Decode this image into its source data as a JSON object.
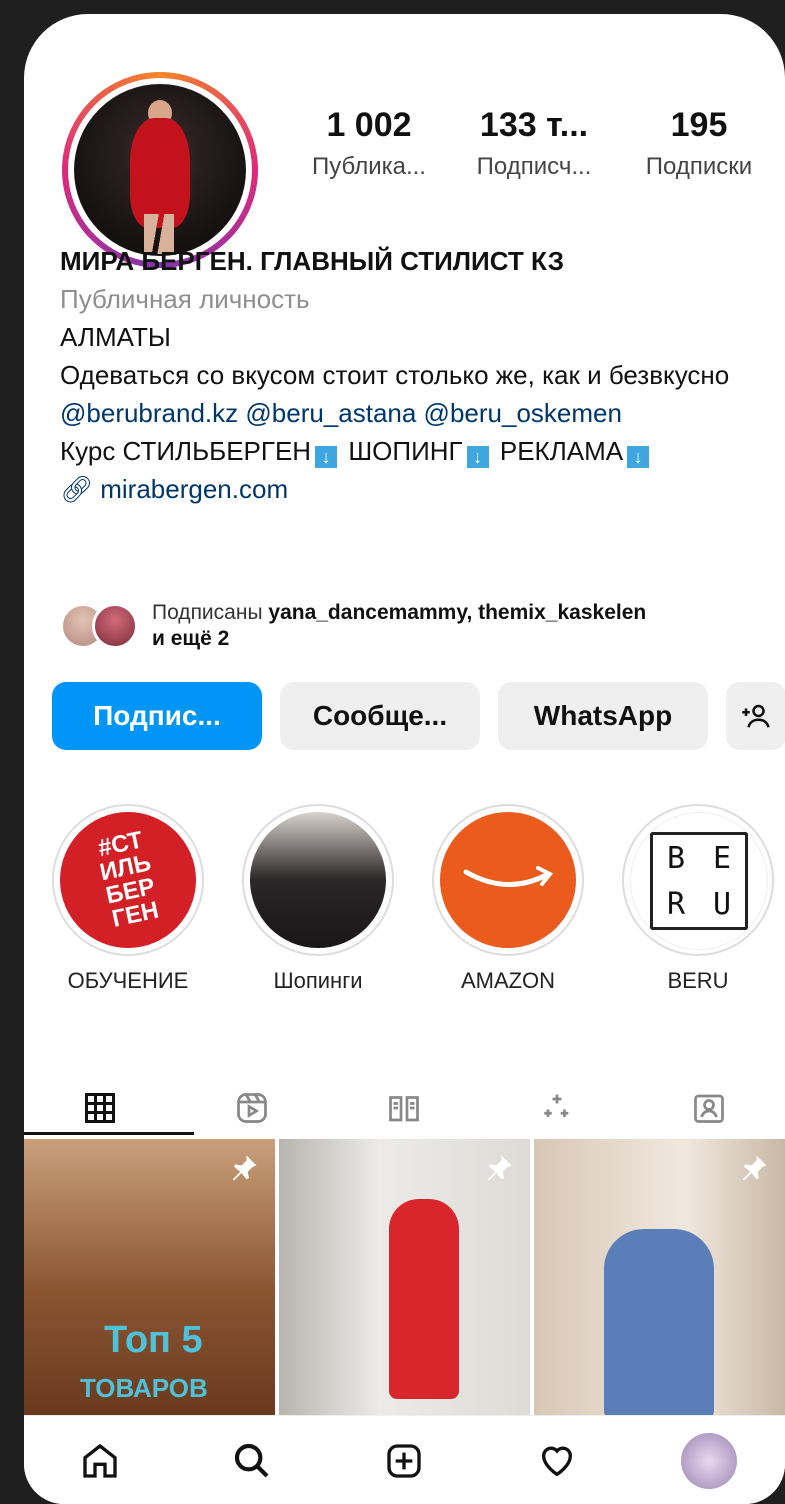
{
  "profile": {
    "stats": [
      {
        "value": "1 002",
        "label": "Публика..."
      },
      {
        "value": "133 т...",
        "label": "Подписч..."
      },
      {
        "value": "195",
        "label": "Подписки"
      }
    ],
    "name": "МИРА БЕРГЕН. ГЛАВНЫЙ СТИЛИСТ КЗ",
    "category": "Публичная личность",
    "city": "АЛМАТЫ",
    "bio_line": "Одеваться со вкусом стоит столько же, как и безвкусно",
    "mentions": "@berubrand.kz @beru_astana @beru_oskemen",
    "course_line": {
      "part1": "Курс СТИЛЬБЕРГЕН",
      "part2": "ШОПИНГ",
      "part3": "РЕКЛАМА"
    },
    "website": "mirabergen.com"
  },
  "followed_by": {
    "prefix": "Подписаны",
    "names": "yana_dancemammy, themix_kaskelen",
    "suffix": "и ещё 2"
  },
  "buttons": {
    "follow": "Подпис...",
    "message": "Сообще...",
    "whatsapp": "WhatsApp",
    "add_icon": "add-person-icon"
  },
  "highlights": [
    {
      "label": "ОБУЧЕНИЕ",
      "cover_text": "#СТИЛЬБЕРГЕН"
    },
    {
      "label": "Шопинги"
    },
    {
      "label": "AMAZON"
    },
    {
      "label": "BERU",
      "cover_text": "BERU"
    }
  ],
  "beru_letters": [
    "B",
    "E",
    "R",
    "U"
  ],
  "highlight_red_text": [
    "#СТ",
    "ИЛЬ",
    "БЕР",
    "ГЕН"
  ],
  "tabs": [
    "grid-icon",
    "reels-icon",
    "guide-icon",
    "effects-icon",
    "tagged-icon"
  ],
  "posts": [
    {
      "overlay": "Топ 5",
      "overlay2": "ТОВАРОВ",
      "pinned": true
    },
    {
      "pinned": true
    },
    {
      "pinned": true
    }
  ],
  "nav": [
    "home-icon",
    "search-icon",
    "create-icon",
    "activity-icon",
    "profile-icon"
  ],
  "colors": {
    "accent": "#0095f6",
    "link": "#00376b",
    "ring_start": "#f58529",
    "ring_end": "#dd2a7b"
  }
}
